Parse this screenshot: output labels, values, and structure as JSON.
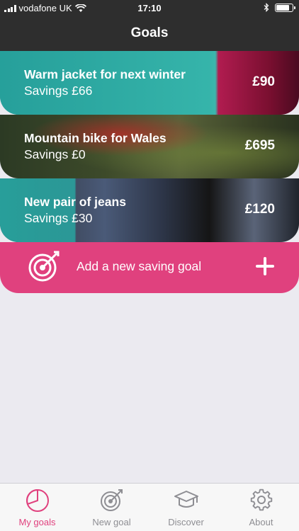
{
  "status_bar": {
    "carrier": "vodafone UK",
    "time": "17:10",
    "icons": [
      "signal-icon",
      "wifi-icon",
      "bluetooth-icon",
      "battery-icon"
    ]
  },
  "nav": {
    "title": "Goals"
  },
  "goals": [
    {
      "name": "Warm jacket for next winter",
      "savings": "Savings £66",
      "price": "£90"
    },
    {
      "name": "Mountain bike for Wales",
      "savings": "Savings £0",
      "price": "£695"
    },
    {
      "name": "New pair of jeans",
      "savings": "Savings £30",
      "price": "£120"
    }
  ],
  "add_goal": {
    "label": "Add a new saving goal",
    "icon": "target-icon",
    "action_icon": "plus-icon"
  },
  "tabs": [
    {
      "label": "My goals",
      "icon": "pie-chart-icon",
      "active": true
    },
    {
      "label": "New goal",
      "icon": "target-icon",
      "active": false
    },
    {
      "label": "Discover",
      "icon": "graduation-cap-icon",
      "active": false
    },
    {
      "label": "About",
      "icon": "gear-icon",
      "active": false
    }
  ],
  "colors": {
    "accent": "#e0417e",
    "header": "#2e2e2e",
    "background": "#ebeaf0",
    "tab_inactive": "#8e8e93"
  }
}
